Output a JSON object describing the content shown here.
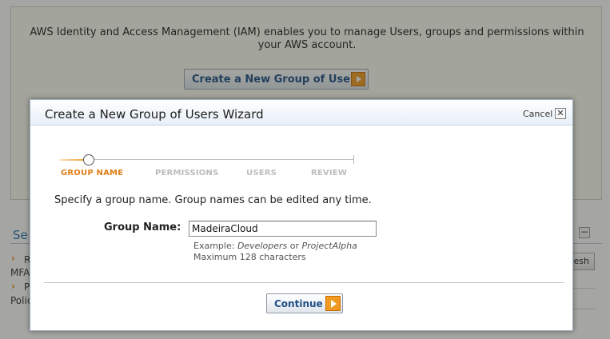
{
  "background": {
    "intro_text": "AWS Identity and Access Management (IAM) enables you to manage Users, groups and permissions within your AWS account.",
    "create_group_button": "Create a New Group of Users",
    "section_title_fragment": "Se",
    "collapse_glyph": "−",
    "refresh_button_fragment": "esh",
    "list_fragments": [
      "R",
      "MFA",
      "P",
      "Polic"
    ]
  },
  "dialog": {
    "title": "Create a New Group of Users Wizard",
    "cancel_label": "Cancel",
    "close_glyph": "✕",
    "steps": [
      {
        "label": "GROUP NAME",
        "active": true
      },
      {
        "label": "PERMISSIONS",
        "active": false
      },
      {
        "label": "USERS",
        "active": false
      },
      {
        "label": "REVIEW",
        "active": false
      }
    ],
    "instructions": "Specify a group name. Group names can be edited any time.",
    "group_name_label": "Group Name:",
    "group_name_value": "MadeiraCloud",
    "hint_prefix": "Example: ",
    "hint_example_1": "Developers",
    "hint_or": " or ",
    "hint_example_2": "ProjectAlpha",
    "hint_max": "Maximum 128 characters",
    "continue_label": "Continue"
  },
  "colors": {
    "accent_orange": "#f29a1f",
    "link_blue": "#1f4f86",
    "active_step": "#e07e17"
  },
  "icons": [
    "right-arrow-icon",
    "close-icon",
    "collapse-icon",
    "chevron-right-icon"
  ]
}
